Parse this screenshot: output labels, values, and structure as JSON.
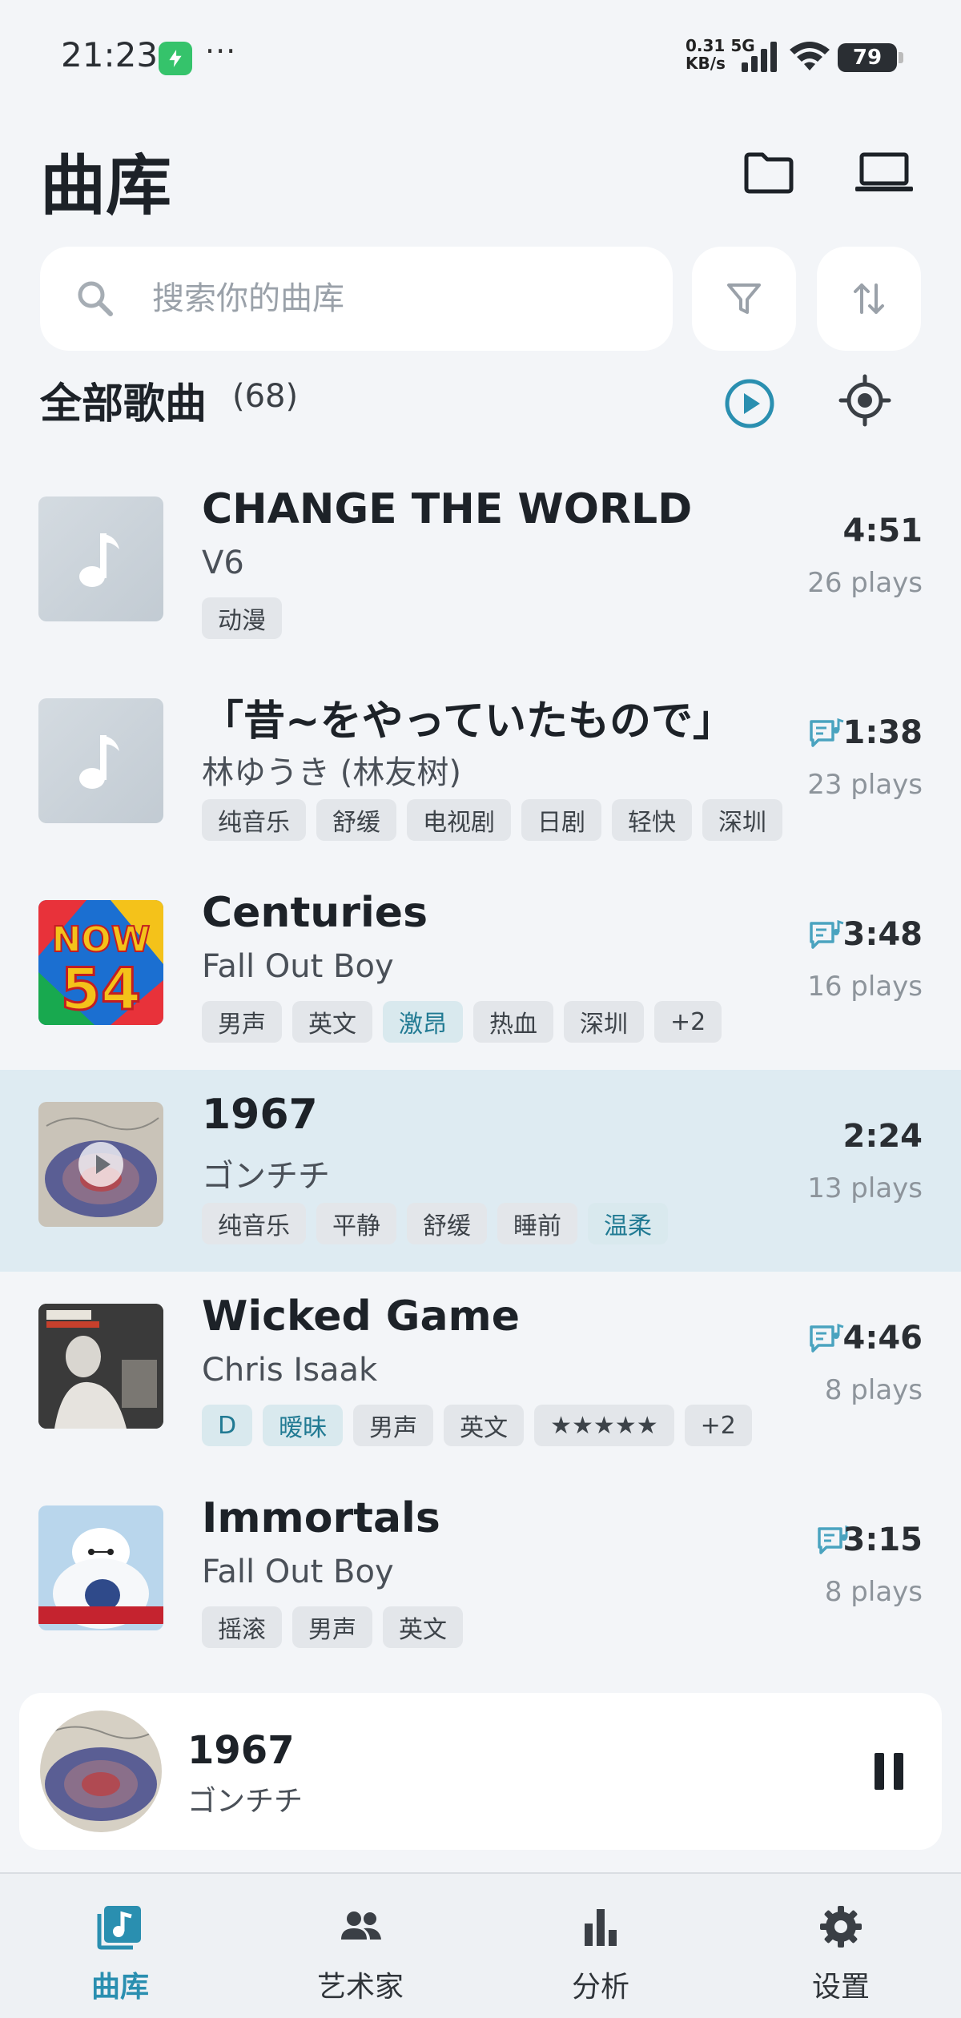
{
  "status_bar": {
    "time": "21:23",
    "more": "···",
    "net_speed": "0.31",
    "net_unit": "KB/s",
    "net_type": "5G",
    "battery": "79"
  },
  "header": {
    "title": "曲库",
    "folder_icon": "folder-icon",
    "device_icon": "laptop-icon"
  },
  "search": {
    "placeholder": "搜索你的曲库",
    "value": ""
  },
  "section": {
    "title": "全部歌曲",
    "count": "(68)"
  },
  "songs": [
    {
      "title": "CHANGE THE WORLD",
      "artist": "V6",
      "duration": "4:51",
      "plays": "26 plays",
      "lyrics": false,
      "cover": "placeholder",
      "tags": [
        {
          "label": "动漫",
          "accent": false
        }
      ]
    },
    {
      "title": "「昔~をやっていたもので」",
      "artist": "林ゆうき (林友树)",
      "duration": "1:38",
      "plays": "23 plays",
      "lyrics": true,
      "cover": "placeholder",
      "tags": [
        {
          "label": "纯音乐",
          "accent": false
        },
        {
          "label": "舒缓",
          "accent": false
        },
        {
          "label": "电视剧",
          "accent": false
        },
        {
          "label": "日剧",
          "accent": false
        },
        {
          "label": "轻快",
          "accent": false
        },
        {
          "label": "深圳",
          "accent": false
        }
      ]
    },
    {
      "title": "Centuries",
      "artist": "Fall Out Boy",
      "duration": "3:48",
      "plays": "16 plays",
      "lyrics": true,
      "cover": "now54",
      "tags": [
        {
          "label": "男声",
          "accent": false
        },
        {
          "label": "英文",
          "accent": false
        },
        {
          "label": "激昂",
          "accent": true
        },
        {
          "label": "热血",
          "accent": false
        },
        {
          "label": "深圳",
          "accent": false
        },
        {
          "label": "+2",
          "accent": false
        }
      ]
    },
    {
      "title": "1967",
      "artist": "ゴンチチ",
      "duration": "2:24",
      "plays": "13 plays",
      "lyrics": false,
      "cover": "1967",
      "active": true,
      "tags": [
        {
          "label": "纯音乐",
          "accent": false
        },
        {
          "label": "平静",
          "accent": false
        },
        {
          "label": "舒缓",
          "accent": false
        },
        {
          "label": "睡前",
          "accent": false
        },
        {
          "label": "温柔",
          "accent": true
        }
      ]
    },
    {
      "title": "Wicked Game",
      "artist": "Chris Isaak",
      "duration": "4:46",
      "plays": "8 plays",
      "lyrics": true,
      "cover": "chris",
      "tags": [
        {
          "label": "D",
          "accent": true
        },
        {
          "label": "暧昧",
          "accent": true
        },
        {
          "label": "男声",
          "accent": false
        },
        {
          "label": "英文",
          "accent": false
        },
        {
          "label": "★★★★★",
          "accent": false
        },
        {
          "label": "+2",
          "accent": false
        }
      ]
    },
    {
      "title": "Immortals",
      "artist": "Fall Out Boy",
      "duration": "3:15",
      "plays": "8 plays",
      "lyrics": true,
      "cover": "baymax",
      "tags": [
        {
          "label": "摇滚",
          "accent": false
        },
        {
          "label": "男声",
          "accent": false
        },
        {
          "label": "英文",
          "accent": false
        }
      ]
    }
  ],
  "mini_player": {
    "title": "1967",
    "artist": "ゴンチチ"
  },
  "nav": [
    {
      "label": "曲库",
      "icon": "library-icon",
      "active": true
    },
    {
      "label": "艺术家",
      "icon": "artists-icon",
      "active": false
    },
    {
      "label": "分析",
      "icon": "analytics-icon",
      "active": false
    },
    {
      "label": "设置",
      "icon": "settings-icon",
      "active": false
    }
  ],
  "colors": {
    "accent": "#2a8fb0",
    "background": "#f3f5f8",
    "active_row": "#deebf2"
  }
}
